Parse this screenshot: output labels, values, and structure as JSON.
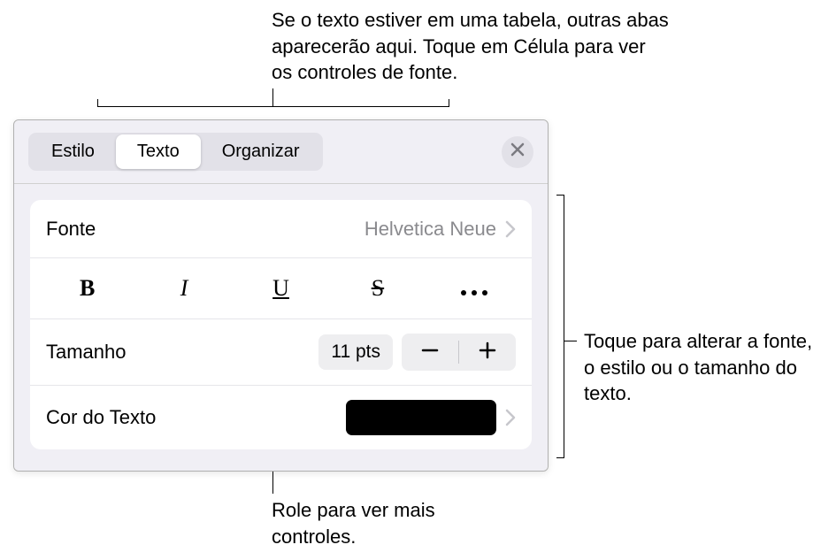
{
  "callouts": {
    "top": "Se o texto estiver em uma tabela, outras abas aparecerão aqui. Toque em Célula para ver os controles de fonte.",
    "right": "Toque para alterar a fonte, o estilo ou o tamanho do texto.",
    "bottom": "Role para ver mais controles."
  },
  "tabs": {
    "style": "Estilo",
    "text": "Texto",
    "arrange": "Organizar"
  },
  "rows": {
    "font": {
      "label": "Fonte",
      "value": "Helvetica Neue"
    },
    "styles": {
      "bold": "B",
      "italic": "I",
      "underline": "U",
      "strike": "S"
    },
    "size": {
      "label": "Tamanho",
      "value": "11 pts"
    },
    "textColor": {
      "label": "Cor do Texto",
      "value": "#000000"
    }
  }
}
